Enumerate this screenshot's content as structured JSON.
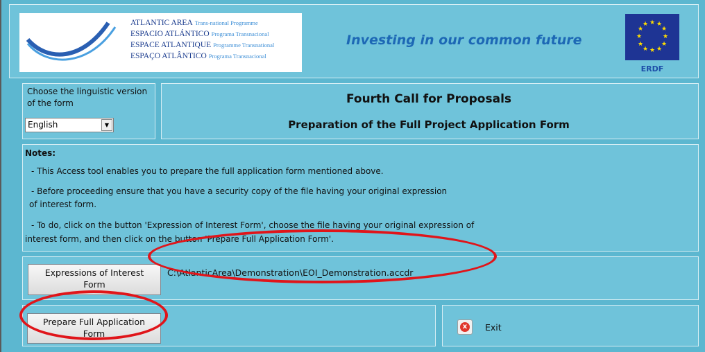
{
  "header": {
    "logo_lines": [
      {
        "main": "ATLANTIC AREA",
        "sub": "Trans-national Programme"
      },
      {
        "main": "ESPACIO ATLÁNTICO",
        "sub": "Programa Transnacional"
      },
      {
        "main": "ESPACE ATLANTIQUE",
        "sub": "Programme Transnational"
      },
      {
        "main": "ESPAÇO ATLÂNTICO",
        "sub": "Programa Transnacional"
      }
    ],
    "tagline": "Investing in our common future",
    "erdf": "ERDF"
  },
  "language": {
    "label": "Choose the linguistic version of the form",
    "selected": "English"
  },
  "titles": {
    "main": "Fourth Call for Proposals",
    "sub": "Preparation of the Full Project Application Form"
  },
  "notes": {
    "title": "Notes:",
    "lines": [
      "- This Access tool enables you to prepare the full application form mentioned above.",
      "- Before proceeding ensure that you have a security copy of the file having your original expression",
      "of interest form.",
      "- To do, click on the button 'Expression of Interest Form', choose the file having your original expression of",
      "interest form, and then click on the button 'Prepare Full Application Form'."
    ]
  },
  "buttons": {
    "expressions": "Expressions of Interest Form",
    "file_path": "C:\\AtlanticArea\\Demonstration\\EOI_Demonstration.accdr",
    "prepare": "Prepare Full Application Form",
    "exit": "Exit"
  },
  "colors": {
    "background": "#5cb7d0",
    "panel": "#6fc3da",
    "annotation": "#e0151a",
    "tagline": "#1d68b5"
  }
}
